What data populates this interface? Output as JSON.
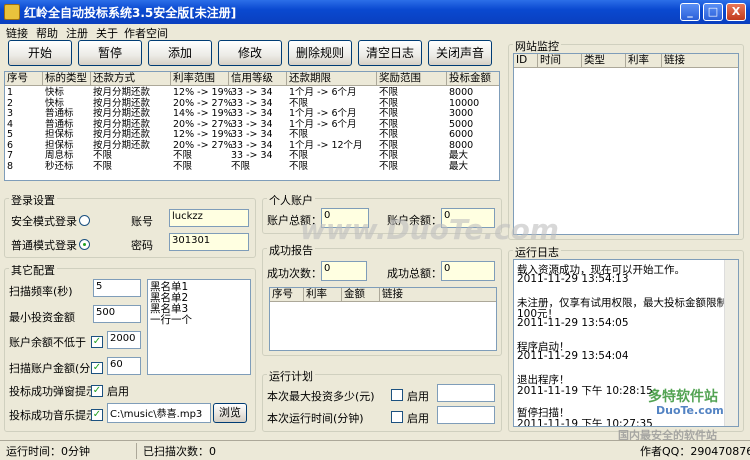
{
  "window": {
    "title": "红岭全自动投标系统3.5安全版[未注册]",
    "min_label": "_",
    "max_label": "□",
    "close_label": "X"
  },
  "menu": [
    "链接",
    "帮助",
    "注册",
    "关于",
    "作者空间"
  ],
  "toolbar": [
    "开始",
    "暂停",
    "添加",
    "修改",
    "删除规则",
    "清空日志",
    "关闭声音"
  ],
  "rules": {
    "headers": [
      "序号",
      "标的类型",
      "还款方式",
      "利率范围",
      "信用等级",
      "还款期限",
      "奖励范围",
      "投标金额"
    ],
    "rows": [
      [
        "1",
        "快标",
        "按月分期还款",
        "12% -> 19%",
        "33 -> 34",
        "1个月 -> 6个月",
        "不限",
        "8000"
      ],
      [
        "2",
        "快标",
        "按月分期还款",
        "20% -> 27%",
        "33 -> 34",
        "不限",
        "不限",
        "10000"
      ],
      [
        "3",
        "普通标",
        "按月分期还款",
        "14% -> 19%",
        "33 -> 34",
        "1个月 -> 6个月",
        "不限",
        "3000"
      ],
      [
        "4",
        "普通标",
        "按月分期还款",
        "20% -> 27%",
        "33 -> 34",
        "1个月 -> 6个月",
        "不限",
        "5000"
      ],
      [
        "5",
        "担保标",
        "按月分期还款",
        "12% -> 19%",
        "33 -> 34",
        "不限",
        "不限",
        "6000"
      ],
      [
        "6",
        "担保标",
        "按月分期还款",
        "20% -> 27%",
        "33 -> 34",
        "1个月 -> 12个月",
        "不限",
        "8000"
      ],
      [
        "7",
        "周息标",
        "不限",
        "不限",
        "33 -> 34",
        "不限",
        "不限",
        "最大"
      ],
      [
        "8",
        "秒还标",
        "不限",
        "不限",
        "不限",
        "不限",
        "不限",
        "最大"
      ]
    ]
  },
  "monitor": {
    "title": "网站监控",
    "headers": [
      "ID",
      "时间",
      "类型",
      "利率",
      "链接"
    ]
  },
  "login": {
    "title": "登录设置",
    "safe_mode": "安全模式登录",
    "normal_mode": "普通模式登录",
    "account_label": "账号",
    "account_value": "luckzz",
    "password_label": "密码",
    "password_value": "301301"
  },
  "account": {
    "title": "个人账户",
    "total_label": "账户总额：",
    "total_value": "0",
    "balance_label": "账户余额：",
    "balance_value": "0"
  },
  "success": {
    "title": "成功报告",
    "count_label": "成功次数：",
    "count_value": "0",
    "amount_label": "成功总额：",
    "amount_value": "0",
    "headers": [
      "序号",
      "利率",
      "金额",
      "链接"
    ]
  },
  "other": {
    "title": "其它配置",
    "freq_label": "扫描频率(秒)",
    "freq_value": "5",
    "min_label": "最小投资金额",
    "min_value": "500",
    "balance_label": "账户余额不低于",
    "balance_value": "2000",
    "scan_label": "扫描账户金额(分)",
    "scan_value": "60",
    "popup_label": "投标成功弹窗提示",
    "popup_enable": "启用",
    "music_label": "投标成功音乐提示",
    "music_path": "C:\\music\\恭喜.mp3",
    "browse": "浏览",
    "blacklist": [
      "黑名单1",
      "黑名单2",
      "黑名单3",
      "一行一个"
    ]
  },
  "plan": {
    "title": "运行计划",
    "max_label": "本次最大投资多少(元)",
    "time_label": "本次运行时间(分钟)",
    "enable": "启用"
  },
  "log": {
    "title": "运行日志",
    "lines": [
      "载入资源成功，现在可以开始工作。",
      "2011-11-29 13:54:13",
      "",
      "未注册，仅享有试用权限，最大投标金额限制为",
      "100元！",
      "2011-11-29 13:54:05",
      "",
      "程序启动！",
      "2011-11-29 13:54:04",
      "",
      "退出程序！",
      "2011-11-19 下午 10:28:15",
      "",
      "暂停扫描！",
      "2011-11-19 下午 10:27:35"
    ]
  },
  "status": {
    "runtime": "运行时间：0分钟",
    "scans": "已扫描次数：0",
    "author": "作者QQ：290470876"
  },
  "watermarks": {
    "duote": "www.DuoTe.com",
    "duote2": "多特软件站",
    "duote3": "DuoTe.com",
    "slogan": "国内最安全的软件站"
  }
}
